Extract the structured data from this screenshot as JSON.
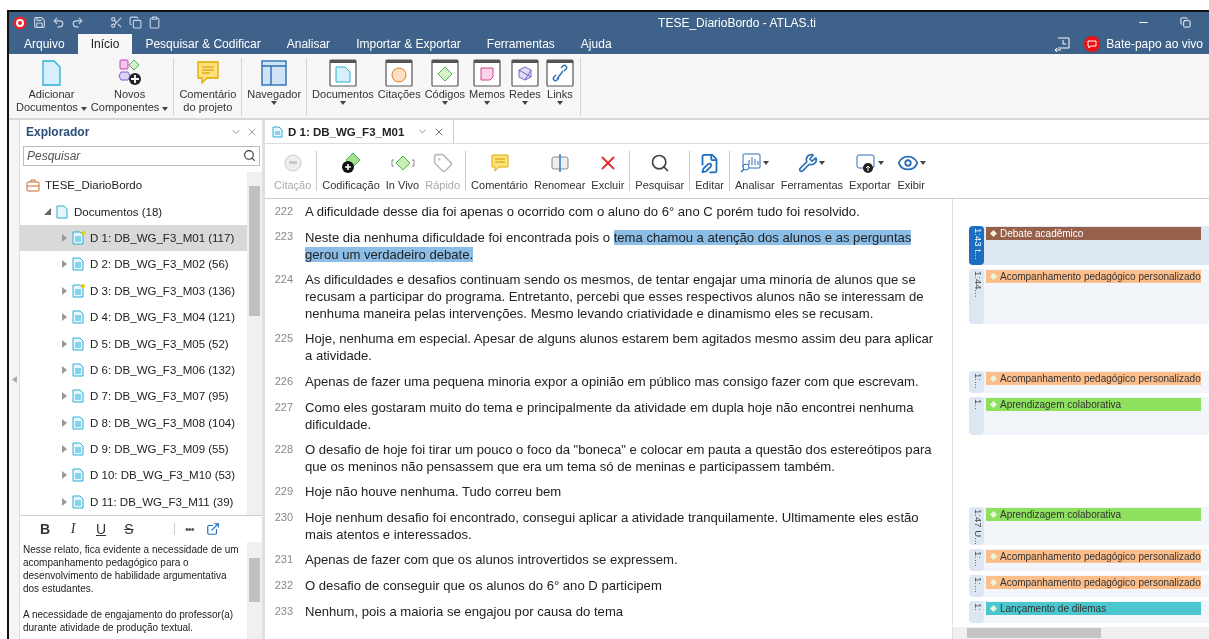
{
  "window": {
    "title": "TESE_DiarioBordo - ATLAS.ti"
  },
  "menu_tabs": [
    {
      "label": "Arquivo",
      "selected": false
    },
    {
      "label": "Início",
      "selected": true
    },
    {
      "label": "Pesquisar & Codificar",
      "selected": false
    },
    {
      "label": "Analisar",
      "selected": false
    },
    {
      "label": "Importar & Exportar",
      "selected": false
    },
    {
      "label": "Ferramentas",
      "selected": false
    },
    {
      "label": "Ajuda",
      "selected": false
    }
  ],
  "live_chat": {
    "label": "Bate-papo ao vivo"
  },
  "ribbon": {
    "groups": [
      {
        "buttons": [
          {
            "kind": "add-document",
            "lines": [
              "Adicionar",
              "Documentos"
            ],
            "dropdown": true
          },
          {
            "kind": "components",
            "lines": [
              "Novos",
              "Componentes"
            ],
            "dropdown": true
          }
        ]
      },
      {
        "buttons": [
          {
            "kind": "comment",
            "lines": [
              "Comentário",
              "do projeto"
            ],
            "dropdown": false
          }
        ]
      },
      {
        "buttons": [
          {
            "kind": "navigator",
            "lines": [
              "Navegador"
            ],
            "dropdown": true
          }
        ]
      },
      {
        "buttons": [
          {
            "kind": "documents",
            "lines": [
              "Documentos"
            ],
            "dropdown": true
          },
          {
            "kind": "quotations",
            "lines": [
              "Citações"
            ],
            "dropdown": false
          },
          {
            "kind": "codes",
            "lines": [
              "Códigos"
            ],
            "dropdown": true
          },
          {
            "kind": "memos",
            "lines": [
              "Memos"
            ],
            "dropdown": true
          },
          {
            "kind": "networks",
            "lines": [
              "Redes"
            ],
            "dropdown": true
          },
          {
            "kind": "links",
            "lines": [
              "Links"
            ],
            "dropdown": true
          }
        ]
      }
    ]
  },
  "explorer": {
    "title": "Explorador",
    "search": {
      "placeholder": "Pesquisar"
    },
    "project": "TESE_DiarioBordo",
    "folder": {
      "label": "Documentos (18)",
      "expanded": true,
      "children": [
        {
          "label": "D 1: DB_WG_F3_M01 (117)",
          "selected": true,
          "has_memo": true
        },
        {
          "label": "D 2: DB_WG_F3_M02 (56)",
          "selected": false,
          "has_memo": false
        },
        {
          "label": "D 3: DB_WG_F3_M03 (136)",
          "selected": false,
          "has_memo": true
        },
        {
          "label": "D 4: DB_WG_F3_M04 (121)",
          "selected": false,
          "has_memo": false
        },
        {
          "label": "D 5: DB_WG_F3_M05 (52)",
          "selected": false,
          "has_memo": false
        },
        {
          "label": "D 6: DB_WG_F3_M06 (132)",
          "selected": false,
          "has_memo": false
        },
        {
          "label": "D 7: DB_WG_F3_M07 (95)",
          "selected": false,
          "has_memo": false
        },
        {
          "label": "D 8: DB_WG_F3_M08 (104)",
          "selected": false,
          "has_memo": false
        },
        {
          "label": "D 9: DB_WG_F3_M09 (55)",
          "selected": false,
          "has_memo": false
        },
        {
          "label": "D 10: DB_WG_F3_M10 (53)",
          "selected": false,
          "has_memo": false
        },
        {
          "label": "D 11: DB_WG_F3_M11 (39)",
          "selected": false,
          "has_memo": false
        }
      ]
    }
  },
  "memo": {
    "format_buttons": [
      {
        "kind": "bold",
        "label": "B"
      },
      {
        "kind": "italic",
        "label": "I"
      },
      {
        "kind": "underline",
        "label": "U"
      },
      {
        "kind": "strike",
        "label": "S"
      }
    ],
    "more": "•••",
    "paragraphs": [
      "Nesse relato, fica evidente a necessidade de um acompanhamento pedagógico para o desenvolvimento de habilidade argumentativa dos estudantes.",
      "A necessidade de engajamento do professor(a) durante atividade de produção textual."
    ]
  },
  "document_tab": {
    "label": "D 1: DB_WG_F3_M01"
  },
  "toolbar": {
    "groups": [
      [
        {
          "kind": "quote",
          "label": "Citação",
          "disabled": true,
          "dropdown": false
        }
      ],
      [
        {
          "kind": "code-add",
          "label": "Codificação",
          "disabled": false,
          "dropdown": false
        },
        {
          "kind": "in-vivo",
          "label": "In Vivo",
          "disabled": false,
          "dropdown": false
        },
        {
          "kind": "tag",
          "label": "Rápido",
          "disabled": true,
          "dropdown": false
        }
      ],
      [
        {
          "kind": "comment",
          "label": "Comentário",
          "disabled": false,
          "dropdown": false
        },
        {
          "kind": "rename",
          "label": "Renomear",
          "disabled": false,
          "dropdown": false
        },
        {
          "kind": "delete",
          "label": "Excluir",
          "disabled": false,
          "dropdown": false
        }
      ],
      [
        {
          "kind": "search",
          "label": "Pesquisar",
          "disabled": false,
          "dropdown": false
        }
      ],
      [
        {
          "kind": "edit",
          "label": "Editar",
          "disabled": false,
          "dropdown": false
        }
      ],
      [
        {
          "kind": "analyze",
          "label": "Analisar",
          "disabled": false,
          "dropdown": true
        },
        {
          "kind": "tools",
          "label": "Ferramentas",
          "disabled": false,
          "dropdown": true
        },
        {
          "kind": "export",
          "label": "Exportar",
          "disabled": false,
          "dropdown": true
        },
        {
          "kind": "view",
          "label": "Exibir",
          "disabled": false,
          "dropdown": true
        }
      ]
    ]
  },
  "lines": [
    {
      "number": "222",
      "segments": [
        {
          "text": "A dificuldade desse dia foi apenas o ocorrido com o aluno do 6° ano C porém tudo foi resolvido.",
          "highlighted": false
        }
      ]
    },
    {
      "number": "223",
      "segments": [
        {
          "text": "Neste dia nenhuma dificuldade foi encontrada pois o ",
          "highlighted": false
        },
        {
          "text": "tema chamou a atenção dos alunos e as perguntas gerou um verdadeiro debate.",
          "highlighted": true
        }
      ],
      "quotation": {
        "label": "1:43 t...",
        "selected": true,
        "codes": [
          {
            "label": "Debate acadêmico",
            "color": "#96604a"
          }
        ]
      }
    },
    {
      "number": "224",
      "segments": [
        {
          "text": "As dificuldades e desafios continuam sendo os mesmos, de tentar engajar uma minoria de alunos que se recusam a participar do programa. Entretanto, percebi que esses respectivos alunos não se interessam de nenhuma maneira pelas intervenções. Mesmo levando criatividade e dinamismo eles se recusam.",
          "highlighted": false
        }
      ],
      "quotation": {
        "label": "1:44...",
        "selected": false,
        "codes": [
          {
            "label": "Acompanhamento pedagógico personalizado",
            "color": "#fcbf8c"
          }
        ]
      }
    },
    {
      "number": "225",
      "segments": [
        {
          "text": "Hoje, nenhuma em especial. Apesar de alguns alunos estarem bem agitados mesmo assim deu para aplicar a atividade.",
          "highlighted": false
        }
      ]
    },
    {
      "number": "226",
      "segments": [
        {
          "text": "Apenas de fazer uma pequena minoria expor a opinião em público mas consigo fazer com que escrevam.",
          "highlighted": false
        }
      ],
      "quotation": {
        "label": "1:...",
        "selected": false,
        "codes": [
          {
            "label": "Acompanhamento pedagógico personalizado",
            "color": "#fcbf8c"
          }
        ]
      }
    },
    {
      "number": "227",
      "segments": [
        {
          "text": "Como eles gostaram muito do tema e principalmente da atividade em dupla hoje não encontrei nenhuma dificuldade.",
          "highlighted": false
        }
      ],
      "quotation": {
        "label": "1..",
        "selected": false,
        "codes": [
          {
            "label": "Aprendizagem colaborativa",
            "color": "#8ee05f"
          }
        ]
      }
    },
    {
      "number": "228",
      "segments": [
        {
          "text": "O desafio de hoje foi tirar um pouco o foco da \"boneca\" e colocar em pauta a questão dos estereótipos para que os meninos não pensassem que era um tema só de meninas e participassem também.",
          "highlighted": false
        }
      ]
    },
    {
      "number": "229",
      "segments": [
        {
          "text": "Hoje não houve nenhuma. Tudo correu bem",
          "highlighted": false
        }
      ]
    },
    {
      "number": "230",
      "segments": [
        {
          "text": "Hoje nenhum desafio foi encontrado, consegui aplicar a atividade tranquilamente. Ultimamente eles estão mais atentos e interessados.",
          "highlighted": false
        }
      ],
      "quotation": {
        "label": "1:47 U...",
        "selected": false,
        "codes": [
          {
            "label": "Aprendizagem colaborativa",
            "color": "#8ee05f"
          }
        ]
      }
    },
    {
      "number": "231",
      "segments": [
        {
          "text": "Apenas de fazer com que os alunos introvertidos se expressem.",
          "highlighted": false
        }
      ],
      "quotation": {
        "label": "1:...",
        "selected": false,
        "codes": [
          {
            "label": "Acompanhamento pedagógico personalizado",
            "color": "#fcbf8c"
          }
        ]
      }
    },
    {
      "number": "232",
      "segments": [
        {
          "text": "O desafio de conseguir que os alunos do 6° ano D participem",
          "highlighted": false
        }
      ],
      "quotation": {
        "label": "1:...",
        "selected": false,
        "codes": [
          {
            "label": "Acompanhamento pedagógico personalizado",
            "color": "#fcbf8c"
          }
        ]
      }
    },
    {
      "number": "233",
      "segments": [
        {
          "text": "Nenhum, pois a maioria se engajou por causa do tema",
          "highlighted": false
        }
      ],
      "quotation": {
        "label": "1:",
        "selected": false,
        "codes": [
          {
            "label": "Lançamento de dilemas",
            "color": "#4cc6cf"
          }
        ]
      }
    }
  ]
}
